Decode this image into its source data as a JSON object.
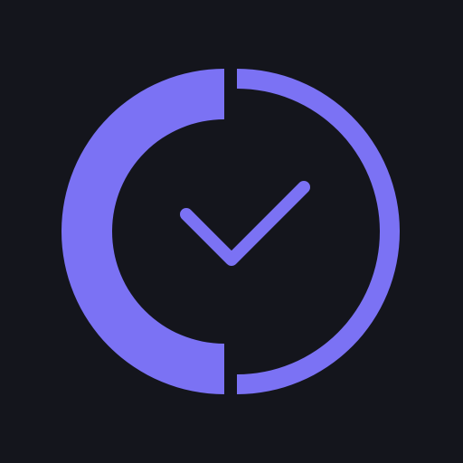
{
  "app_icon": {
    "name": "clock-check-icon",
    "colors": {
      "background": "#14151c",
      "accent": "#7b72f4"
    }
  }
}
